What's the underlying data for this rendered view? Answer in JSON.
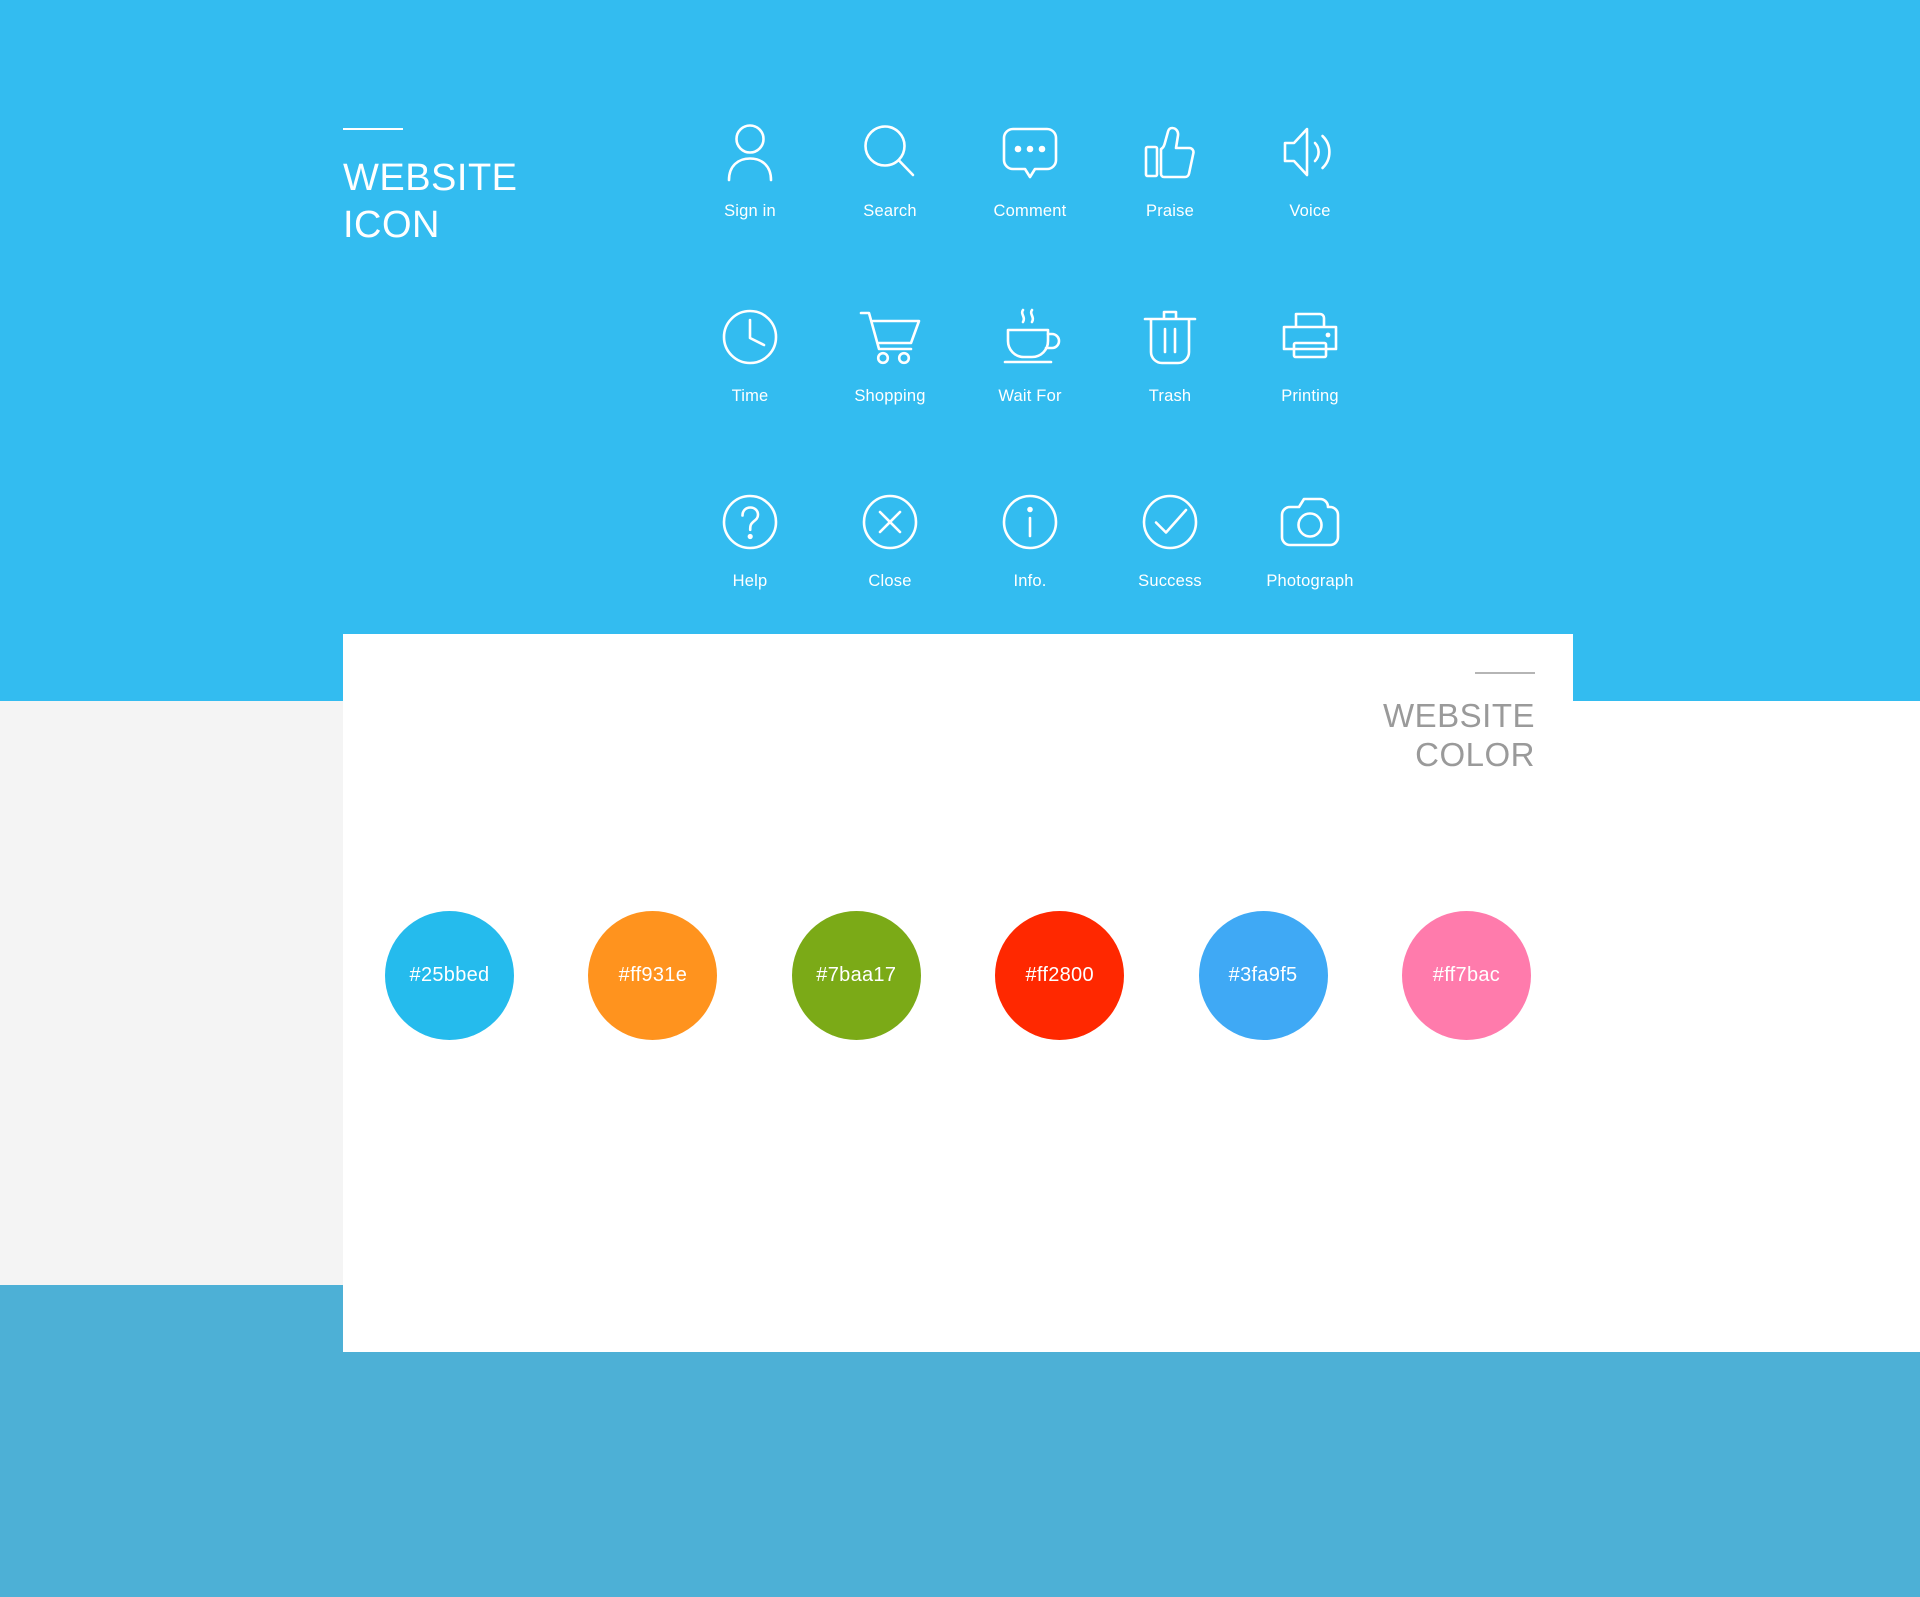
{
  "page": {
    "background_top": "#33bcf0",
    "background_mid": "#f4f4f4",
    "background_bottom": "#4db0d6",
    "card_background": "#ffffff"
  },
  "icon_section": {
    "heading": "WEBSITE\nICON",
    "icons": [
      {
        "label": "Sign in",
        "icon": "user-icon"
      },
      {
        "label": "Search",
        "icon": "magnifier-icon"
      },
      {
        "label": "Comment",
        "icon": "speech-bubble-icon"
      },
      {
        "label": "Praise",
        "icon": "thumbs-up-icon"
      },
      {
        "label": "Voice",
        "icon": "speaker-icon"
      },
      {
        "label": "Time",
        "icon": "clock-icon"
      },
      {
        "label": "Shopping",
        "icon": "shopping-cart-icon"
      },
      {
        "label": "Wait For",
        "icon": "coffee-cup-icon"
      },
      {
        "label": "Trash",
        "icon": "trash-can-icon"
      },
      {
        "label": "Printing",
        "icon": "printer-icon"
      },
      {
        "label": "Help",
        "icon": "question-circle-icon"
      },
      {
        "label": "Close",
        "icon": "close-circle-icon"
      },
      {
        "label": "Info.",
        "icon": "info-circle-icon"
      },
      {
        "label": "Success",
        "icon": "check-circle-icon"
      },
      {
        "label": "Photograph",
        "icon": "camera-icon"
      }
    ]
  },
  "color_section": {
    "heading": "WEBSITE\nCOLOR",
    "swatches": [
      {
        "label": "#25bbed",
        "hex": "#25bbed"
      },
      {
        "label": "#ff931e",
        "hex": "#ff931e"
      },
      {
        "label": "#7baa17",
        "hex": "#7baa17"
      },
      {
        "label": "#ff2800",
        "hex": "#ff2800"
      },
      {
        "label": "#3fa9f5",
        "hex": "#3fa9f5"
      },
      {
        "label": "#ff7bac",
        "hex": "#ff7bac"
      }
    ]
  }
}
